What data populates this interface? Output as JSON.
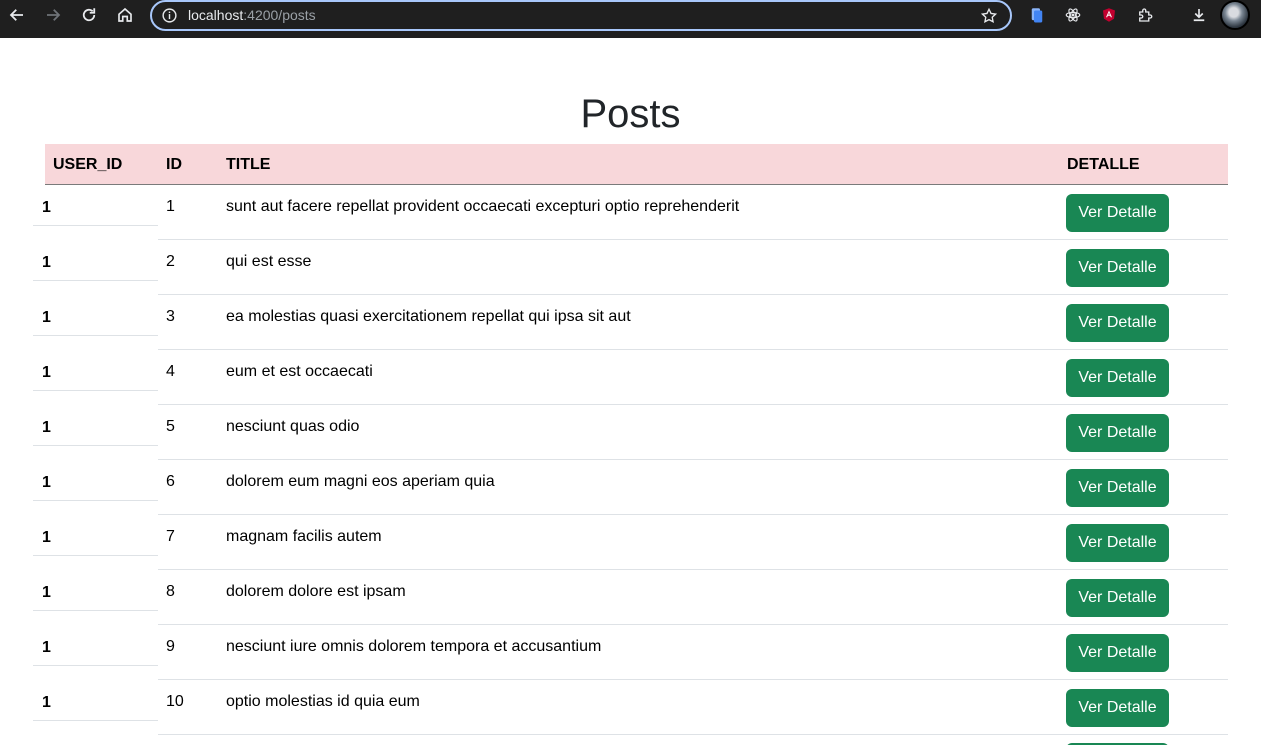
{
  "browser": {
    "url_host": "localhost",
    "url_rest": ":4200/posts"
  },
  "page": {
    "title": "Posts"
  },
  "table": {
    "headers": {
      "user_id": "USER_ID",
      "id": "ID",
      "title": "TITLE",
      "detalle": "DETALLE"
    },
    "button_label": "Ver Detalle",
    "rows": [
      {
        "user_id": "1",
        "id": "1",
        "title": "sunt aut facere repellat provident occaecati excepturi optio reprehenderit"
      },
      {
        "user_id": "1",
        "id": "2",
        "title": "qui est esse"
      },
      {
        "user_id": "1",
        "id": "3",
        "title": "ea molestias quasi exercitationem repellat qui ipsa sit aut"
      },
      {
        "user_id": "1",
        "id": "4",
        "title": "eum et est occaecati"
      },
      {
        "user_id": "1",
        "id": "5",
        "title": "nesciunt quas odio"
      },
      {
        "user_id": "1",
        "id": "6",
        "title": "dolorem eum magni eos aperiam quia"
      },
      {
        "user_id": "1",
        "id": "7",
        "title": "magnam facilis autem"
      },
      {
        "user_id": "1",
        "id": "8",
        "title": "dolorem dolore est ipsam"
      },
      {
        "user_id": "1",
        "id": "9",
        "title": "nesciunt iure omnis dolorem tempora et accusantium"
      },
      {
        "user_id": "1",
        "id": "10",
        "title": "optio molestias id quia eum"
      }
    ]
  },
  "colors": {
    "header_bg": "#f8d7da",
    "button_bg": "#198754",
    "chrome_bg": "#1f1f1f",
    "omnibox_border": "#a8c7fa"
  },
  "icons": {
    "nav": [
      "back-arrow-icon",
      "forward-arrow-icon",
      "reload-icon",
      "home-icon"
    ],
    "omnibox": [
      "info-icon",
      "bookmark-star-icon"
    ],
    "extensions": [
      "file-extension-icon",
      "react-devtools-icon",
      "angular-devtools-icon",
      "puzzle-extensions-icon",
      "download-icon"
    ]
  }
}
